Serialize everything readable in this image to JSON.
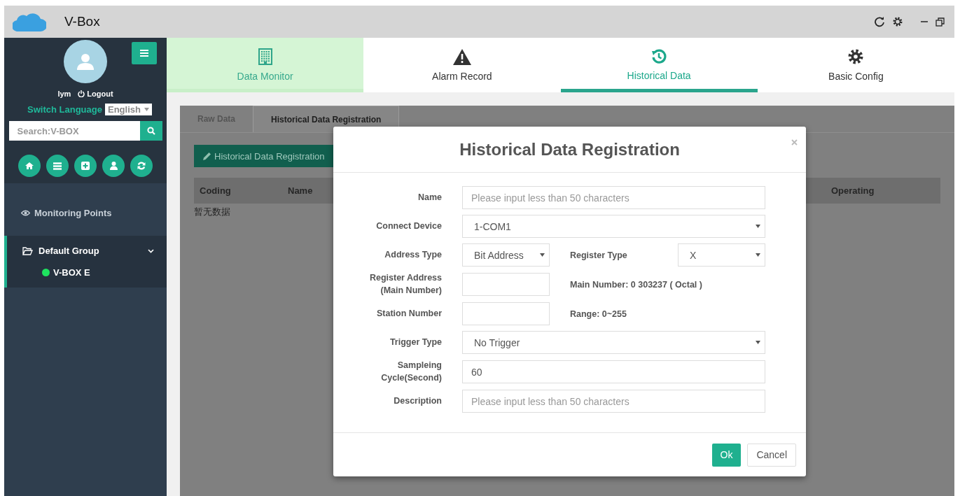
{
  "app": {
    "title": "V-Box"
  },
  "sidebar": {
    "user": "lym",
    "logout": "Logout",
    "language_label": "Switch Language",
    "language": "English",
    "search": {
      "placeholder": "Search:V-BOX"
    },
    "section": "Monitoring Points",
    "groups": [
      {
        "label": "Default Group",
        "expanded": true,
        "selected": true,
        "children": [
          {
            "label": "V-BOX E",
            "color": "#1ee35f"
          }
        ]
      }
    ]
  },
  "nav_tabs": [
    {
      "label": "Data Monitor",
      "selected": false,
      "hovered": true
    },
    {
      "label": "Alarm Record",
      "selected": false,
      "hovered": false
    },
    {
      "label": "Historical Data",
      "selected": true,
      "hovered": false
    },
    {
      "label": "Basic Config",
      "selected": false,
      "hovered": false
    }
  ],
  "panel": {
    "tabs": [
      {
        "label": "Raw Data",
        "selected": false
      },
      {
        "label": "Historical Data Registration",
        "selected": true
      }
    ],
    "add_button": "Historical Data Registration",
    "table": {
      "columns": [
        "Coding",
        "Name",
        "Operating"
      ],
      "empty_text": "暂无数据"
    }
  },
  "dialog": {
    "title": "Historical Data Registration",
    "fields": [
      {
        "label": "Name",
        "kind": "text",
        "placeholder": "Please input less than 50 characters"
      },
      {
        "label": "Connect Device",
        "kind": "select",
        "value": "1-COM1"
      },
      {
        "label": "Address Type",
        "kind": "select",
        "value": "Bit Address",
        "side": {
          "kind": "select",
          "label": "Register Type",
          "value": "X"
        }
      },
      {
        "label": "Register Address (Main Number)",
        "kind": "text",
        "side": {
          "kind": "note",
          "text": "Main Number: 0 303237 ( Octal )"
        }
      },
      {
        "label": "Station Number",
        "kind": "text",
        "side": {
          "kind": "note",
          "text": "Range: 0~255"
        }
      },
      {
        "label": "Trigger Type",
        "kind": "select",
        "value": "No Trigger"
      },
      {
        "label": "Sampleing Cycle(Second)",
        "kind": "text",
        "value": "60"
      },
      {
        "label": "Description",
        "kind": "text",
        "placeholder": "Please input less than 50 characters"
      }
    ],
    "ok": "Ok",
    "cancel": "Cancel"
  }
}
